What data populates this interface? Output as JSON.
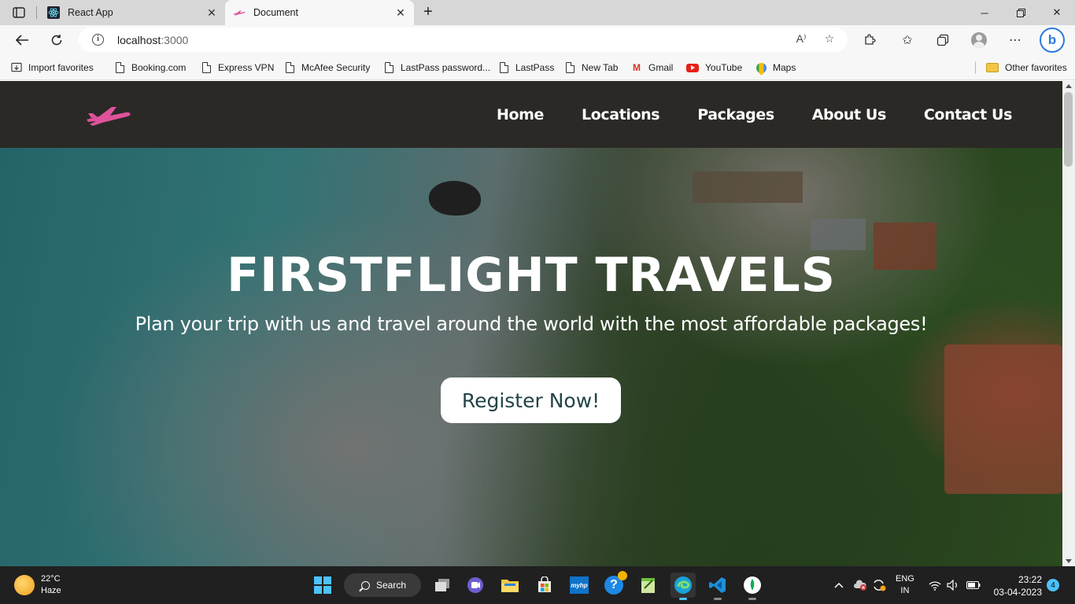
{
  "browser": {
    "tabs": [
      {
        "title": "React App",
        "active": false
      },
      {
        "title": "Document",
        "active": true
      }
    ],
    "address": {
      "host": "localhost",
      "port": ":3000"
    },
    "favorites": [
      {
        "label": "Import favorites",
        "icon": "import-icon"
      },
      {
        "label": "Booking.com",
        "icon": "page-icon"
      },
      {
        "label": "Express VPN",
        "icon": "page-icon"
      },
      {
        "label": "McAfee Security",
        "icon": "page-icon"
      },
      {
        "label": "LastPass password...",
        "icon": "page-icon"
      },
      {
        "label": "LastPass",
        "icon": "page-icon"
      },
      {
        "label": "New Tab",
        "icon": "page-icon"
      },
      {
        "label": "Gmail",
        "icon": "gmail-icon"
      },
      {
        "label": "YouTube",
        "icon": "youtube-icon"
      },
      {
        "label": "Maps",
        "icon": "maps-icon"
      }
    ],
    "other_favorites": "Other favorites"
  },
  "site": {
    "nav": [
      "Home",
      "Locations",
      "Packages",
      "About Us",
      "Contact Us"
    ],
    "logo_color": "#e0529c",
    "nav_bg": "#2b2925",
    "hero": {
      "title": "FIRSTFLIGHT TRAVELS",
      "subtitle": "Plan your trip with us and travel around the world with the most affordable packages!",
      "cta": "Register Now!",
      "cta_color": "#234449"
    }
  },
  "taskbar": {
    "weather": {
      "temp": "22°C",
      "condition": "Haze"
    },
    "search": "Search",
    "lang": {
      "line1": "ENG",
      "line2": "IN"
    },
    "time": "23:22",
    "date": "03-04-2023",
    "notifications": "4",
    "accent": "#4cc2ff"
  }
}
